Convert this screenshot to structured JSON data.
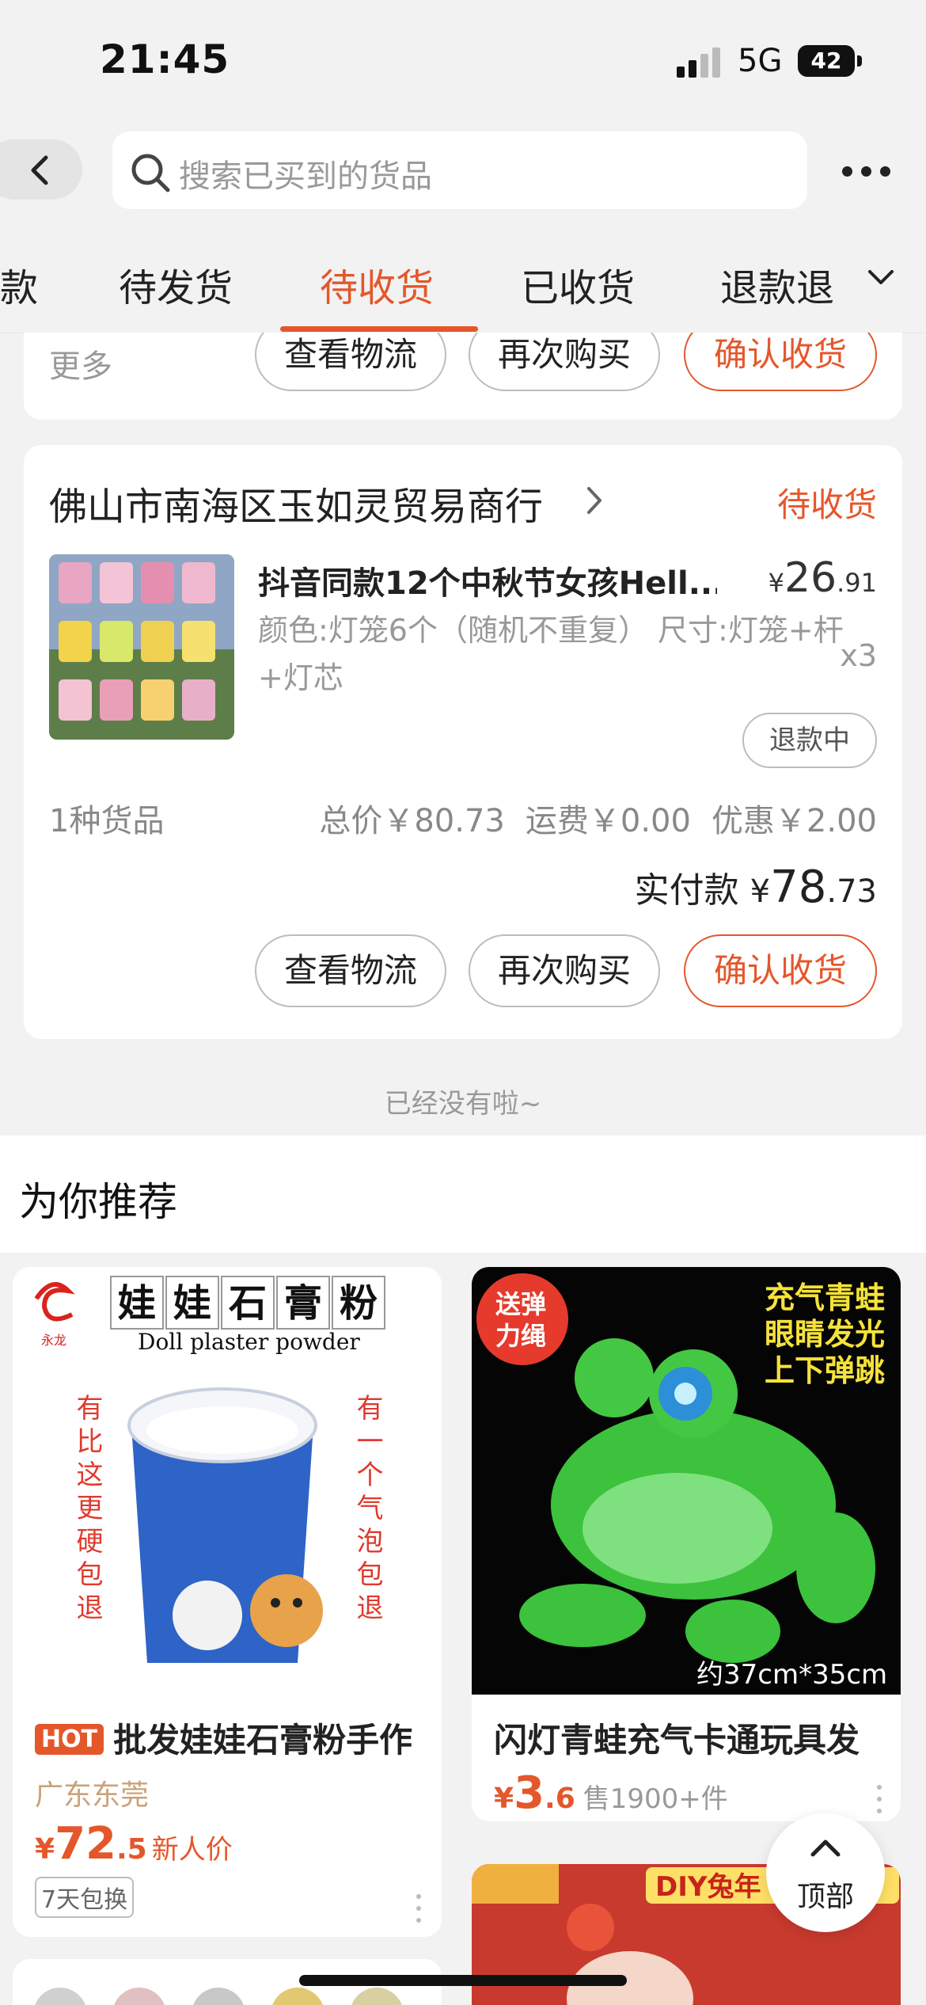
{
  "status_bar": {
    "time": "21:45",
    "network": "5G",
    "battery": "42"
  },
  "header": {
    "search_placeholder": "搜索已买到的货品"
  },
  "tabs": [
    {
      "label": "款"
    },
    {
      "label": "待发货"
    },
    {
      "label": "待收货",
      "active": true
    },
    {
      "label": "已收货"
    },
    {
      "label": "退款退"
    }
  ],
  "prev_order": {
    "more_label": "更多",
    "buttons": {
      "logistics": "查看物流",
      "rebuy": "再次购买",
      "confirm": "确认收货"
    }
  },
  "order": {
    "store_name": "佛山市南海区玉如灵贸易商行",
    "status": "待收货",
    "item": {
      "title": "抖音同款12个中秋节女孩Hell...",
      "price_symbol": "¥",
      "price_int": "26",
      "price_dec": ".91",
      "spec": "颜色:灯笼6个（随机不重复） 尺寸:灯笼+杆+灯芯",
      "qty": "x3",
      "refund_status": "退款中"
    },
    "goods_count": "1种货品",
    "total": "总价￥80.73",
    "shipping": "运费￥0.00",
    "discount": "优惠￥2.00",
    "paid_label": "实付款",
    "paid_symbol": "¥",
    "paid_int": "78",
    "paid_dec": ".73",
    "buttons": {
      "logistics": "查看物流",
      "rebuy": "再次购买",
      "confirm": "确认收货"
    }
  },
  "end_text": "已经没有啦~",
  "recommend": {
    "title": "为你推荐",
    "products": [
      {
        "badge": "HOT",
        "title": "批发娃娃石膏粉手作",
        "location": "广东东莞",
        "price_symbol": "¥",
        "price_int": "72",
        "price_dec": ".5",
        "price_tag": "新人价",
        "service_tag": "7天包换",
        "image_text": {
          "heading": [
            "娃",
            "娃",
            "石",
            "膏",
            "粉"
          ],
          "subheading": "Doll plaster powder",
          "left_column": "有比这更硬包退",
          "right_column": "有一个气泡包退",
          "logo_caption": "永龙"
        }
      },
      {
        "title": "闪灯青蛙充气卡通玩具发",
        "price_symbol": "¥",
        "price_int": "3",
        "price_dec": ".6",
        "sold": "售1900+件",
        "image_text": {
          "corner_badge_line1": "送弹",
          "corner_badge_line2": "力绳",
          "caption_line1": "充气青蛙",
          "caption_line2": "眼睛发光",
          "caption_line3": "上下弹跳",
          "size": "约37cm*35cm"
        }
      },
      {
        "image_text": {
          "banner": "DIY兔年"
        }
      }
    ]
  },
  "top_button": {
    "label": "顶部"
  },
  "colors": {
    "accent": "#e4572b",
    "background": "#f2f2f2",
    "card": "#ffffff"
  }
}
